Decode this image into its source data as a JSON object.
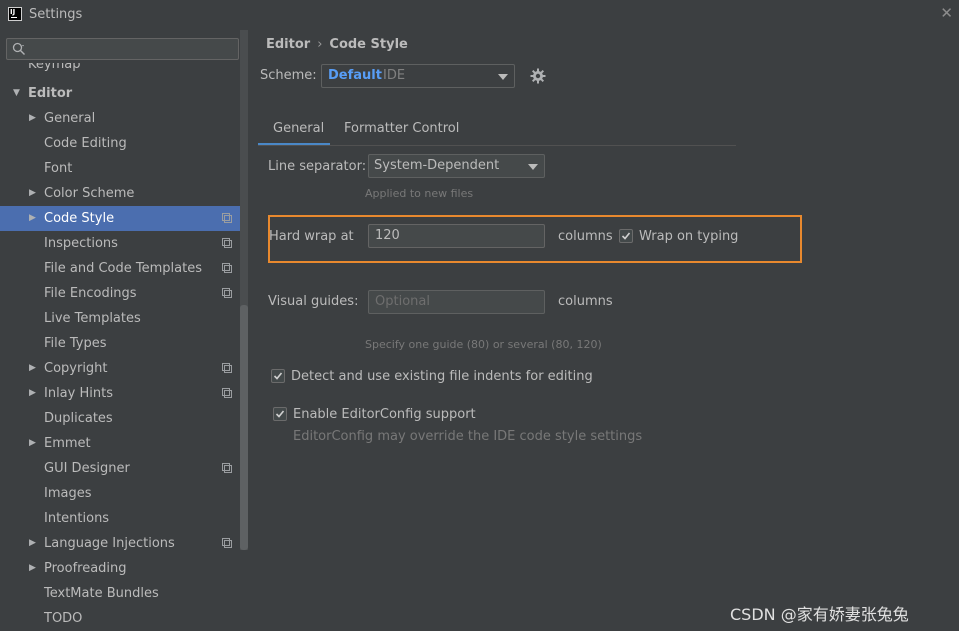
{
  "window": {
    "title": "Settings",
    "logo_text": "IJ"
  },
  "sidebar": {
    "search_placeholder": "",
    "cut_item": "Keymap",
    "section": "Editor",
    "items": [
      {
        "label": "General",
        "arrow": true,
        "copy": false
      },
      {
        "label": "Code Editing",
        "arrow": false,
        "copy": false
      },
      {
        "label": "Font",
        "arrow": false,
        "copy": false
      },
      {
        "label": "Color Scheme",
        "arrow": true,
        "copy": false
      },
      {
        "label": "Code Style",
        "arrow": true,
        "copy": true,
        "selected": true
      },
      {
        "label": "Inspections",
        "arrow": false,
        "copy": true
      },
      {
        "label": "File and Code Templates",
        "arrow": false,
        "copy": true
      },
      {
        "label": "File Encodings",
        "arrow": false,
        "copy": true
      },
      {
        "label": "Live Templates",
        "arrow": false,
        "copy": false
      },
      {
        "label": "File Types",
        "arrow": false,
        "copy": false
      },
      {
        "label": "Copyright",
        "arrow": true,
        "copy": true
      },
      {
        "label": "Inlay Hints",
        "arrow": true,
        "copy": true
      },
      {
        "label": "Duplicates",
        "arrow": false,
        "copy": false
      },
      {
        "label": "Emmet",
        "arrow": true,
        "copy": false
      },
      {
        "label": "GUI Designer",
        "arrow": false,
        "copy": true
      },
      {
        "label": "Images",
        "arrow": false,
        "copy": false
      },
      {
        "label": "Intentions",
        "arrow": false,
        "copy": false
      },
      {
        "label": "Language Injections",
        "arrow": true,
        "copy": true
      },
      {
        "label": "Proofreading",
        "arrow": true,
        "copy": false
      },
      {
        "label": "TextMate Bundles",
        "arrow": false,
        "copy": false
      },
      {
        "label": "TODO",
        "arrow": false,
        "copy": false
      }
    ]
  },
  "breadcrumb": {
    "parent": "Editor",
    "separator": "›",
    "current": "Code Style"
  },
  "scheme": {
    "label": "Scheme:",
    "name": "Default",
    "scope": "IDE"
  },
  "tabs": {
    "general": "General",
    "formatter": "Formatter Control"
  },
  "general": {
    "line_separator_label": "Line separator:",
    "line_separator_value": "System-Dependent",
    "line_separator_hint": "Applied to new files",
    "hard_wrap_label": "Hard wrap at",
    "hard_wrap_value": "120",
    "columns_label": "columns",
    "wrap_on_typing_label": "Wrap on typing",
    "wrap_on_typing_checked": true,
    "visual_guides_label": "Visual guides:",
    "visual_guides_placeholder": "Optional",
    "visual_guides_hint": "Specify one guide (80) or several (80, 120)",
    "detect_indents_label": "Detect and use existing file indents for editing",
    "detect_indents_checked": true,
    "editorconfig_label": "Enable EditorConfig support",
    "editorconfig_checked": true,
    "editorconfig_hint": "EditorConfig may override the IDE code style settings"
  },
  "watermark": "CSDN @家有娇妻张兔兔",
  "colors": {
    "accent": "#4b6eaf",
    "highlight": "#e8892e",
    "link": "#589df6",
    "background": "#3c3f41"
  }
}
